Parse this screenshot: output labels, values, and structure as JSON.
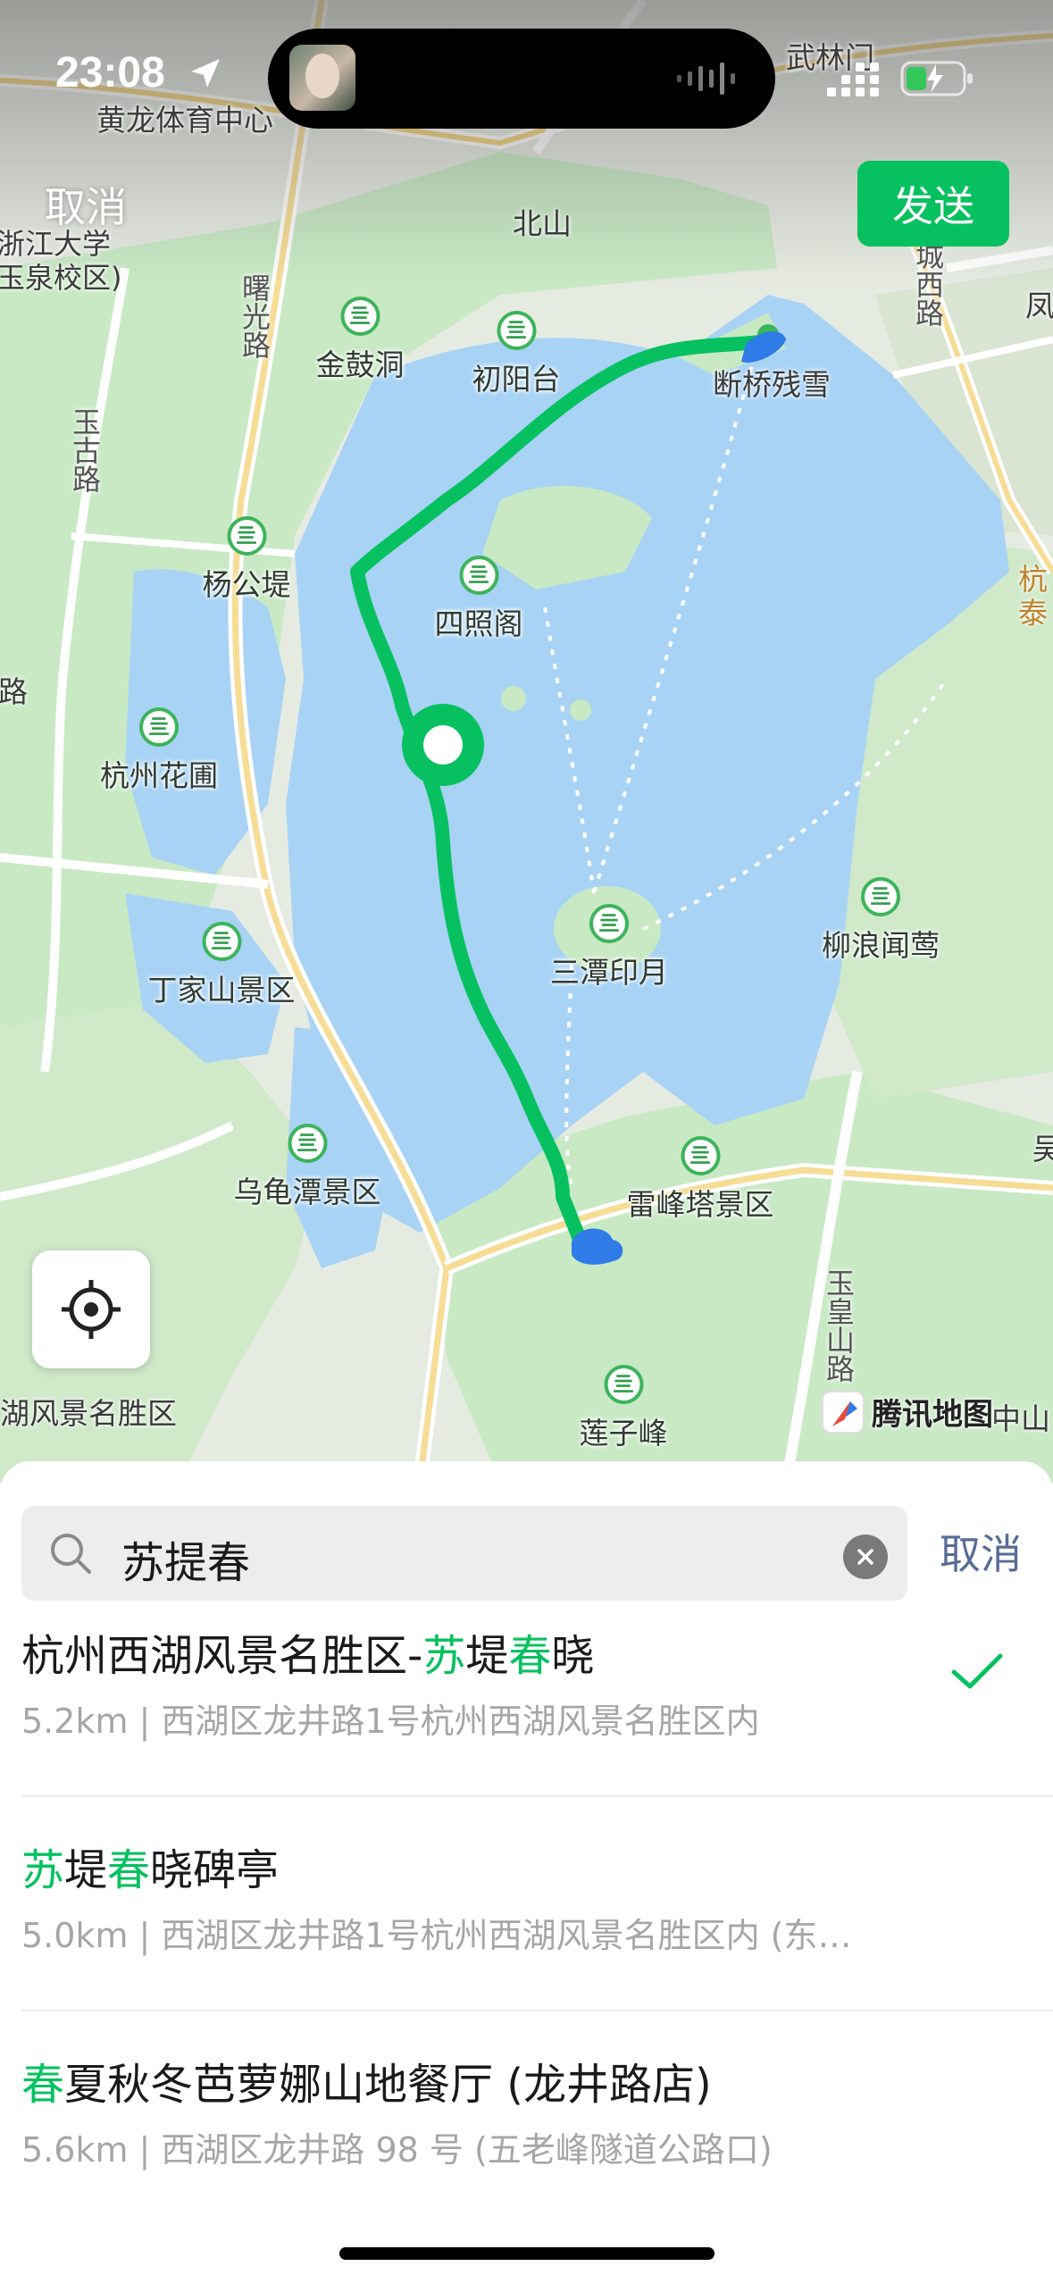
{
  "status_bar": {
    "time": "23:08",
    "colors": {
      "text": "#ffffff"
    }
  },
  "map": {
    "cancel_label": "取消",
    "send_label": "发送",
    "provider_label": "腾讯地图",
    "labels": {
      "huanglong": "黄龙体育中心",
      "wulinmen": "武林门",
      "beishan": "北山",
      "zju": "浙江大学",
      "zju_campus": "玉泉校区)",
      "feng": "凤",
      "jinguchong": "金鼓洞",
      "chuyangtai": "初阳台",
      "duanqiao": "断桥残雪",
      "yanggongdi": "杨公堤",
      "sizhaoge": "四照阁",
      "hangzhou_huapu": "杭州花圃",
      "santan": "三潭印月",
      "liulang": "柳浪闻莺",
      "dingjiashan": "丁家山景区",
      "wuguitan": "乌龟潭景区",
      "leifeng": "雷峰塔景区",
      "lianzifeng": "莲子峰",
      "xihu_area": "湖风景名胜区",
      "hang": "杭",
      "tai": "泰",
      "wu": "吴",
      "zhongshan": "中山",
      "lu_left": "路",
      "road_shuguang": "曙光路",
      "road_yugu": "玉古路",
      "road_huancheng": "城西路",
      "road_yuhuang": "玉皇山路"
    },
    "colors": {
      "route": "#07c160",
      "lake": "#a8d3f5",
      "park": "#c8e9c4",
      "accent": "#07c160"
    }
  },
  "search": {
    "query": "苏提春",
    "cancel_label": "取消"
  },
  "results": [
    {
      "name_parts": [
        {
          "text": "杭州西湖风景名胜区-",
          "hl": false
        },
        {
          "text": "苏",
          "hl": true
        },
        {
          "text": "堤",
          "hl": false
        },
        {
          "text": "春",
          "hl": true
        },
        {
          "text": "晓",
          "hl": false
        }
      ],
      "address": "5.2km | 西湖区龙井路1号杭州西湖风景名胜区内",
      "selected": true
    },
    {
      "name_parts": [
        {
          "text": "苏",
          "hl": true
        },
        {
          "text": "堤",
          "hl": false
        },
        {
          "text": "春",
          "hl": true
        },
        {
          "text": "晓碑亭",
          "hl": false
        }
      ],
      "address": "5.0km | 西湖区龙井路1号杭州西湖风景名胜区内 (东…",
      "selected": false
    },
    {
      "name_parts": [
        {
          "text": "春",
          "hl": true
        },
        {
          "text": "夏秋冬芭萝娜山地餐厅 (龙井路店)",
          "hl": false
        }
      ],
      "address": "5.6km | 西湖区龙井路 98 号 (五老峰隧道公路口)",
      "selected": false
    }
  ]
}
